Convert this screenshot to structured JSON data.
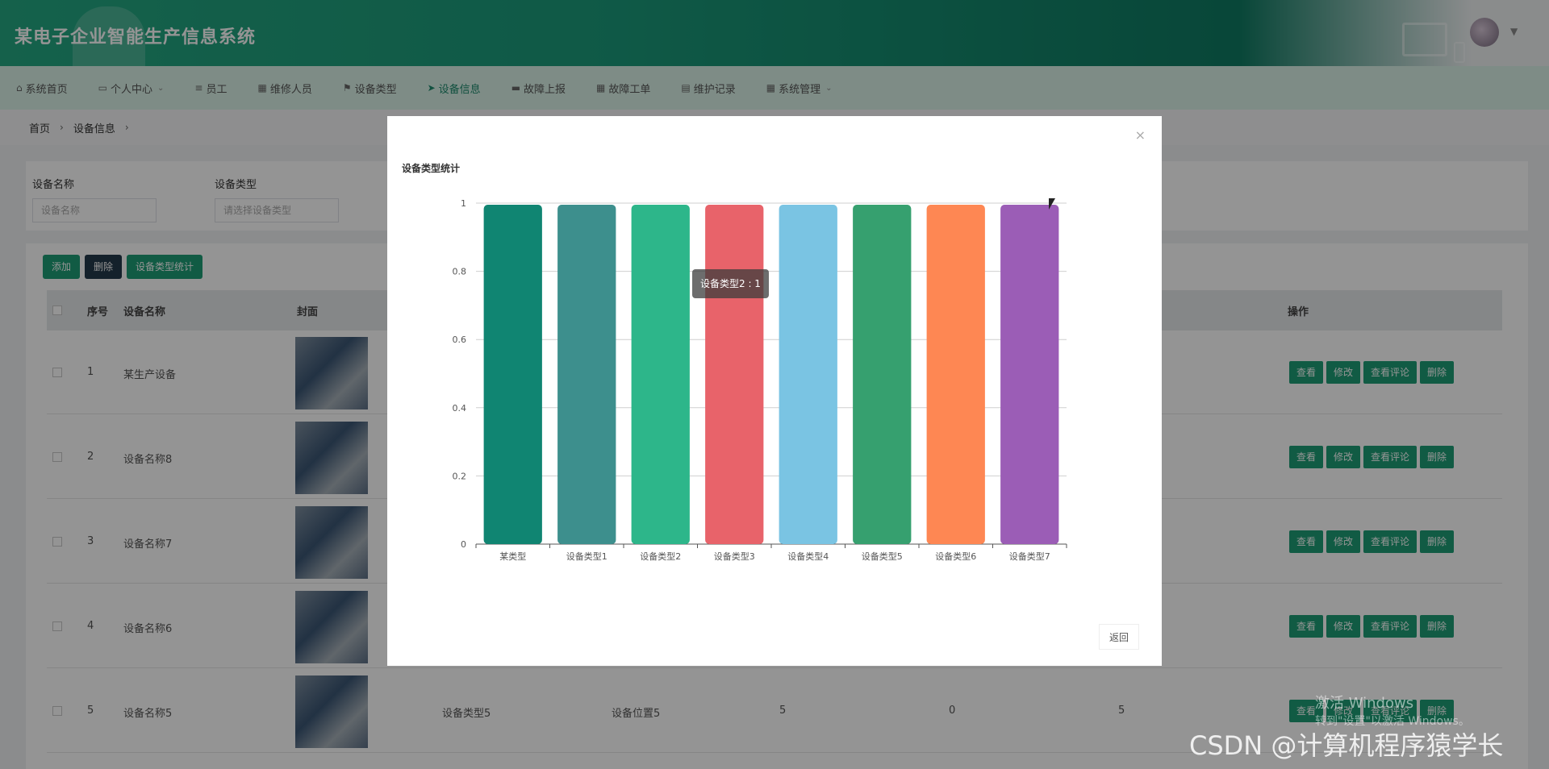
{
  "header": {
    "title": "某电子企业智能生产信息系统"
  },
  "nav": {
    "items": [
      {
        "label": "系统首页",
        "icon": "home-icon",
        "active": false,
        "dropdown": false
      },
      {
        "label": "个人中心",
        "icon": "calendar-icon",
        "active": false,
        "dropdown": true
      },
      {
        "label": "员工",
        "icon": "list-icon",
        "active": false,
        "dropdown": false
      },
      {
        "label": "维修人员",
        "icon": "grid-icon",
        "active": false,
        "dropdown": false
      },
      {
        "label": "设备类型",
        "icon": "flag-icon",
        "active": false,
        "dropdown": false
      },
      {
        "label": "设备信息",
        "icon": "send-icon",
        "active": true,
        "dropdown": false
      },
      {
        "label": "故障上报",
        "icon": "cup-icon",
        "active": false,
        "dropdown": false
      },
      {
        "label": "故障工单",
        "icon": "grid-icon",
        "active": false,
        "dropdown": false
      },
      {
        "label": "维护记录",
        "icon": "clipboard-icon",
        "active": false,
        "dropdown": false
      },
      {
        "label": "系统管理",
        "icon": "grid-icon",
        "active": false,
        "dropdown": true
      }
    ]
  },
  "breadcrumb": {
    "home": "首页",
    "current": "设备信息"
  },
  "search": {
    "name_label": "设备名称",
    "name_placeholder": "设备名称",
    "type_label": "设备类型",
    "type_placeholder": "请选择设备类型"
  },
  "toolbar": {
    "add": "添加",
    "delete": "删除",
    "stats": "设备类型统计"
  },
  "table": {
    "headers": {
      "index": "序号",
      "name": "设备名称",
      "cover": "封面",
      "ops": "操作"
    },
    "rows": [
      {
        "index": "1",
        "name": "某生产设备"
      },
      {
        "index": "2",
        "name": "设备名称8"
      },
      {
        "index": "3",
        "name": "设备名称7"
      },
      {
        "index": "4",
        "name": "设备名称6"
      },
      {
        "index": "5",
        "name": "设备名称5",
        "type": "设备类型5",
        "location": "设备位置5",
        "c1": "5",
        "c2": "0",
        "c3": "5"
      }
    ],
    "actions": {
      "view": "查看",
      "edit": "修改",
      "comments": "查看评论",
      "delete": "删除"
    }
  },
  "modal": {
    "title": "设备类型统计",
    "back": "返回",
    "tooltip": "设备类型2 : 1"
  },
  "chart_data": {
    "type": "bar",
    "categories": [
      "某类型",
      "设备类型1",
      "设备类型2",
      "设备类型3",
      "设备类型4",
      "设备类型5",
      "设备类型6",
      "设备类型7"
    ],
    "values": [
      1,
      1,
      1,
      1,
      1,
      1,
      1,
      1
    ],
    "colors": [
      "#108572",
      "#3d8f8d",
      "#2db68a",
      "#e8636a",
      "#7ac4e3",
      "#36a06f",
      "#fe8753",
      "#9b5db6"
    ],
    "title": "设备类型统计",
    "ylim": [
      0,
      1
    ],
    "yticks": [
      "0",
      "0.2",
      "0.4",
      "0.6",
      "0.8",
      "1"
    ],
    "grid": true
  },
  "watermarks": {
    "windows1": "激活 Windows",
    "windows2": "转到\"设置\"以激活 Windows。",
    "csdn": "CSDN @计算机程序猿学长"
  }
}
